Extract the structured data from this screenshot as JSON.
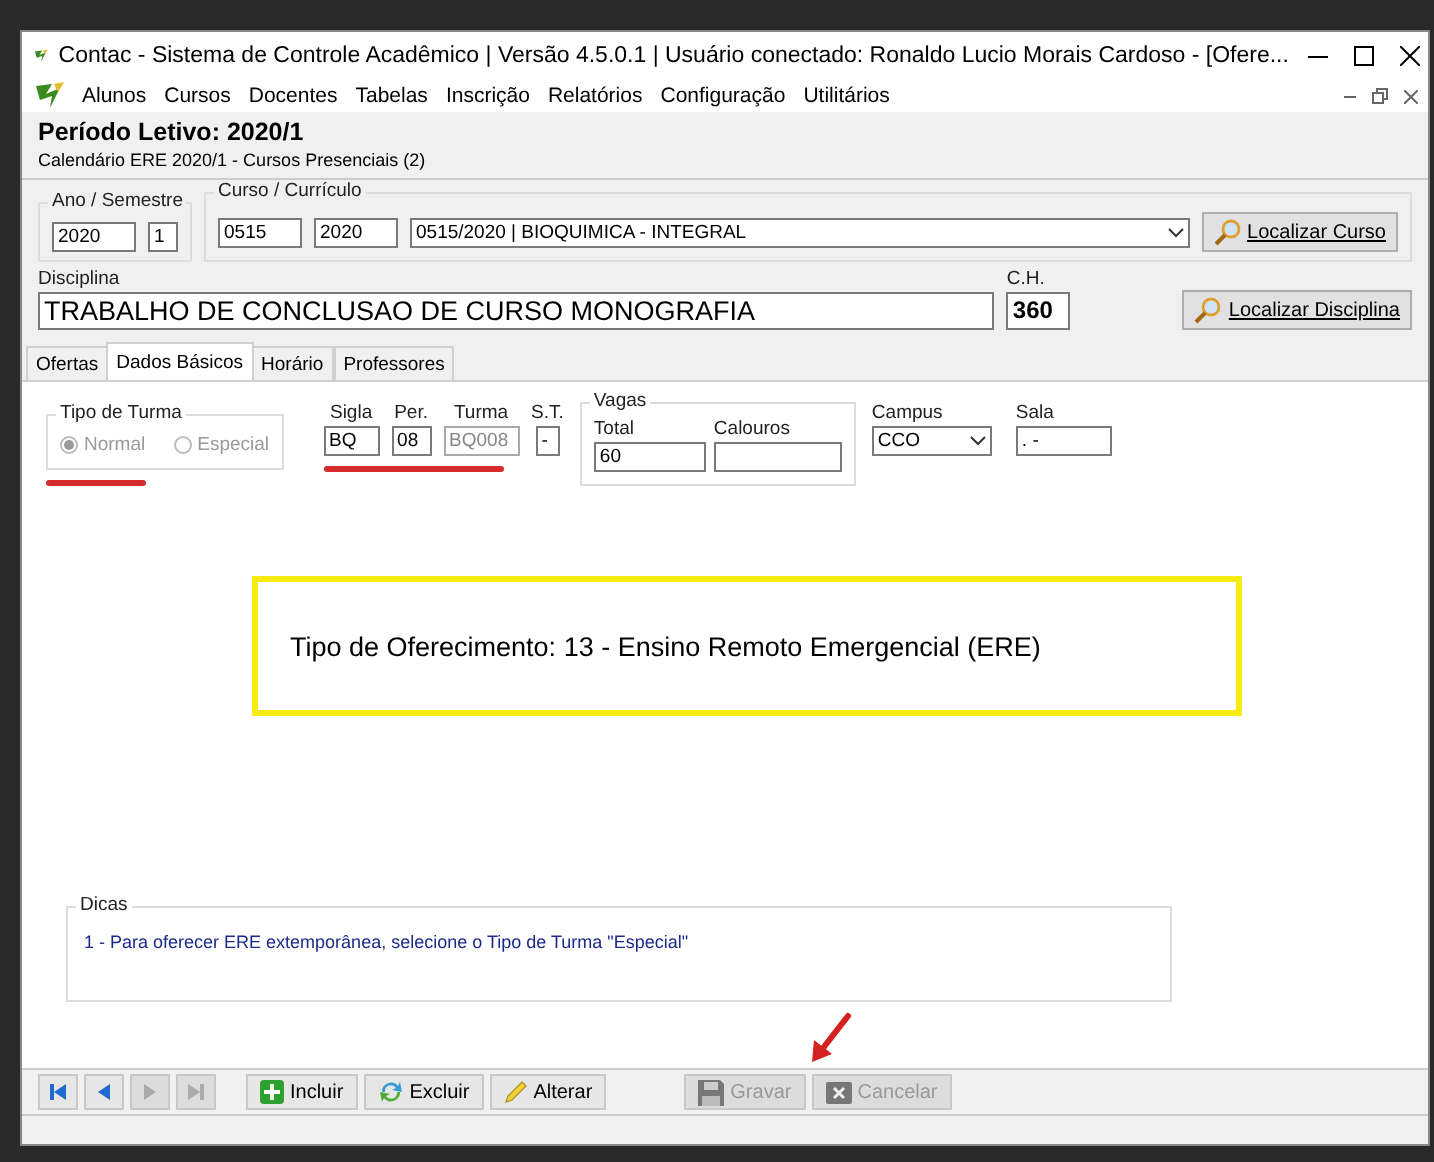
{
  "window": {
    "title": "Contac - Sistema de Controle Acadêmico | Versão 4.5.0.1 | Usuário conectado: Ronaldo Lucio Morais Cardoso - [Ofere..."
  },
  "menu": [
    "Alunos",
    "Cursos",
    "Docentes",
    "Tabelas",
    "Inscrição",
    "Relatórios",
    "Configuração",
    "Utilitários"
  ],
  "header": {
    "title": "Período Letivo: 2020/1",
    "subtitle": "Calendário ERE 2020/1 - Cursos Presenciais (2)"
  },
  "ano_semestre": {
    "label": "Ano / Semestre",
    "ano": "2020",
    "semestre": "1"
  },
  "curso": {
    "label": "Curso / Currículo",
    "codigo": "0515",
    "ano": "2020",
    "curriculo": "0515/2020 | BIOQUIMICA - INTEGRAL",
    "button": "Localizar Curso"
  },
  "disciplina": {
    "label": "Disciplina",
    "value": "TRABALHO DE CONCLUSAO DE CURSO MONOGRAFIA",
    "ch_label": "C.H.",
    "ch": "360",
    "button": "Localizar Disciplina"
  },
  "tabs": [
    {
      "label": "Ofertas",
      "selected": false
    },
    {
      "label": "Dados Básicos",
      "selected": true
    },
    {
      "label": "Horário",
      "selected": false
    },
    {
      "label": "Professores",
      "selected": false
    }
  ],
  "tipo_turma": {
    "label": "Tipo de Turma",
    "options": [
      {
        "label": "Normal",
        "selected": true,
        "disabled": true
      },
      {
        "label": "Especial",
        "selected": false,
        "disabled": true
      }
    ]
  },
  "fields": [
    {
      "label": "Sigla",
      "value": "BQ",
      "disabled": false
    },
    {
      "label": "Per.",
      "value": "08",
      "disabled": false
    },
    {
      "label": "Turma",
      "value": "BQ008",
      "disabled": true
    },
    {
      "label": "S.T.",
      "value": "-",
      "disabled": false
    }
  ],
  "vagas": {
    "label": "Vagas",
    "total_label": "Total",
    "total": "60",
    "calouros_label": "Calouros"
  },
  "campus": {
    "label": "Campus",
    "value": "CCO"
  },
  "sala": {
    "label": "Sala",
    "value": ". -"
  },
  "highlight": "Tipo de Oferecimento:  13 - Ensino Remoto Emergencial (ERE)",
  "dicas": {
    "label": "Dicas",
    "items": [
      "1 - Para oferecer ERE extemporânea, selecione o Tipo de Turma \"Especial\""
    ]
  },
  "nav": [
    {
      "kind": "first",
      "disabled": false
    },
    {
      "kind": "prev",
      "disabled": false
    },
    {
      "kind": "next",
      "disabled": true
    },
    {
      "kind": "last",
      "disabled": true
    }
  ],
  "actions": [
    {
      "kind": "add",
      "label": "Incluir",
      "disabled": false
    },
    {
      "kind": "delete",
      "label": "Excluir",
      "disabled": false
    },
    {
      "kind": "edit",
      "label": "Alterar",
      "disabled": false
    },
    {
      "kind": "save",
      "label": "Gravar",
      "disabled": true
    },
    {
      "kind": "cancel",
      "label": "Cancelar",
      "disabled": true
    }
  ]
}
